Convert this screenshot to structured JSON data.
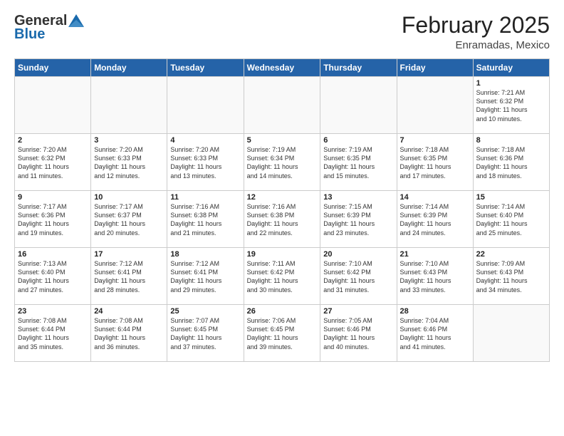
{
  "header": {
    "logo_general": "General",
    "logo_blue": "Blue",
    "month_title": "February 2025",
    "location": "Enramadas, Mexico"
  },
  "days_of_week": [
    "Sunday",
    "Monday",
    "Tuesday",
    "Wednesday",
    "Thursday",
    "Friday",
    "Saturday"
  ],
  "weeks": [
    [
      {
        "num": "",
        "detail": ""
      },
      {
        "num": "",
        "detail": ""
      },
      {
        "num": "",
        "detail": ""
      },
      {
        "num": "",
        "detail": ""
      },
      {
        "num": "",
        "detail": ""
      },
      {
        "num": "",
        "detail": ""
      },
      {
        "num": "1",
        "detail": "Sunrise: 7:21 AM\nSunset: 6:32 PM\nDaylight: 11 hours\nand 10 minutes."
      }
    ],
    [
      {
        "num": "2",
        "detail": "Sunrise: 7:20 AM\nSunset: 6:32 PM\nDaylight: 11 hours\nand 11 minutes."
      },
      {
        "num": "3",
        "detail": "Sunrise: 7:20 AM\nSunset: 6:33 PM\nDaylight: 11 hours\nand 12 minutes."
      },
      {
        "num": "4",
        "detail": "Sunrise: 7:20 AM\nSunset: 6:33 PM\nDaylight: 11 hours\nand 13 minutes."
      },
      {
        "num": "5",
        "detail": "Sunrise: 7:19 AM\nSunset: 6:34 PM\nDaylight: 11 hours\nand 14 minutes."
      },
      {
        "num": "6",
        "detail": "Sunrise: 7:19 AM\nSunset: 6:35 PM\nDaylight: 11 hours\nand 15 minutes."
      },
      {
        "num": "7",
        "detail": "Sunrise: 7:18 AM\nSunset: 6:35 PM\nDaylight: 11 hours\nand 17 minutes."
      },
      {
        "num": "8",
        "detail": "Sunrise: 7:18 AM\nSunset: 6:36 PM\nDaylight: 11 hours\nand 18 minutes."
      }
    ],
    [
      {
        "num": "9",
        "detail": "Sunrise: 7:17 AM\nSunset: 6:36 PM\nDaylight: 11 hours\nand 19 minutes."
      },
      {
        "num": "10",
        "detail": "Sunrise: 7:17 AM\nSunset: 6:37 PM\nDaylight: 11 hours\nand 20 minutes."
      },
      {
        "num": "11",
        "detail": "Sunrise: 7:16 AM\nSunset: 6:38 PM\nDaylight: 11 hours\nand 21 minutes."
      },
      {
        "num": "12",
        "detail": "Sunrise: 7:16 AM\nSunset: 6:38 PM\nDaylight: 11 hours\nand 22 minutes."
      },
      {
        "num": "13",
        "detail": "Sunrise: 7:15 AM\nSunset: 6:39 PM\nDaylight: 11 hours\nand 23 minutes."
      },
      {
        "num": "14",
        "detail": "Sunrise: 7:14 AM\nSunset: 6:39 PM\nDaylight: 11 hours\nand 24 minutes."
      },
      {
        "num": "15",
        "detail": "Sunrise: 7:14 AM\nSunset: 6:40 PM\nDaylight: 11 hours\nand 25 minutes."
      }
    ],
    [
      {
        "num": "16",
        "detail": "Sunrise: 7:13 AM\nSunset: 6:40 PM\nDaylight: 11 hours\nand 27 minutes."
      },
      {
        "num": "17",
        "detail": "Sunrise: 7:12 AM\nSunset: 6:41 PM\nDaylight: 11 hours\nand 28 minutes."
      },
      {
        "num": "18",
        "detail": "Sunrise: 7:12 AM\nSunset: 6:41 PM\nDaylight: 11 hours\nand 29 minutes."
      },
      {
        "num": "19",
        "detail": "Sunrise: 7:11 AM\nSunset: 6:42 PM\nDaylight: 11 hours\nand 30 minutes."
      },
      {
        "num": "20",
        "detail": "Sunrise: 7:10 AM\nSunset: 6:42 PM\nDaylight: 11 hours\nand 31 minutes."
      },
      {
        "num": "21",
        "detail": "Sunrise: 7:10 AM\nSunset: 6:43 PM\nDaylight: 11 hours\nand 33 minutes."
      },
      {
        "num": "22",
        "detail": "Sunrise: 7:09 AM\nSunset: 6:43 PM\nDaylight: 11 hours\nand 34 minutes."
      }
    ],
    [
      {
        "num": "23",
        "detail": "Sunrise: 7:08 AM\nSunset: 6:44 PM\nDaylight: 11 hours\nand 35 minutes."
      },
      {
        "num": "24",
        "detail": "Sunrise: 7:08 AM\nSunset: 6:44 PM\nDaylight: 11 hours\nand 36 minutes."
      },
      {
        "num": "25",
        "detail": "Sunrise: 7:07 AM\nSunset: 6:45 PM\nDaylight: 11 hours\nand 37 minutes."
      },
      {
        "num": "26",
        "detail": "Sunrise: 7:06 AM\nSunset: 6:45 PM\nDaylight: 11 hours\nand 39 minutes."
      },
      {
        "num": "27",
        "detail": "Sunrise: 7:05 AM\nSunset: 6:46 PM\nDaylight: 11 hours\nand 40 minutes."
      },
      {
        "num": "28",
        "detail": "Sunrise: 7:04 AM\nSunset: 6:46 PM\nDaylight: 11 hours\nand 41 minutes."
      },
      {
        "num": "",
        "detail": ""
      }
    ]
  ]
}
